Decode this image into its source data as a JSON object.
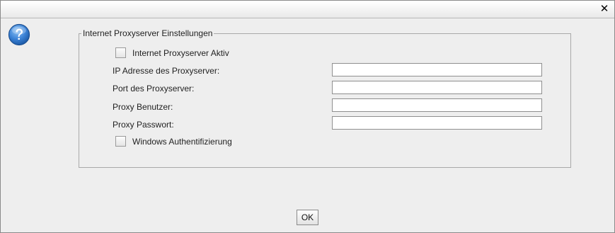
{
  "window": {
    "close_symbol": "✕"
  },
  "help_icon": "question-mark-icon",
  "group": {
    "title": "Internet Proxyserver Einstellungen"
  },
  "proxy_active": {
    "label": "Internet Proxyserver Aktiv",
    "checked": false
  },
  "fields": [
    {
      "label": "IP Adresse des Proxyserver:",
      "value": ""
    },
    {
      "label": "Port des Proxyserver:",
      "value": ""
    },
    {
      "label": "Proxy Benutzer:",
      "value": ""
    },
    {
      "label": "Proxy Passwort:",
      "value": ""
    }
  ],
  "windows_auth": {
    "label": "Windows Authentifizierung",
    "checked": false
  },
  "buttons": {
    "ok_label": "OK"
  },
  "colors": {
    "help_icon_blue": "#2a6fc4",
    "background": "#eeeeee"
  }
}
